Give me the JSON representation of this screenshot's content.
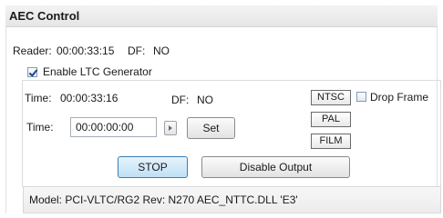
{
  "window": {
    "title": "AEC Control"
  },
  "reader": {
    "label": "Reader:",
    "time": "00:00:33:15",
    "df_label": "DF:",
    "df_value": "NO"
  },
  "ltc": {
    "enable_label": "Enable LTC Generator",
    "enable_checked": true,
    "time_label": "Time:",
    "time_value": "00:00:33:16",
    "df_label": "DF:",
    "df_value": "NO",
    "set_time_label": "Time:",
    "set_time_value": "00:00:00:00",
    "set_label": "Set",
    "ntsc_label": "NTSC",
    "pal_label": "PAL",
    "film_label": "FILM",
    "drop_frame_label": "Drop Frame",
    "drop_frame_checked": false
  },
  "actions": {
    "stop_label": "STOP",
    "disable_label": "Disable Output"
  },
  "status": {
    "model_text": "Model: PCI-VLTC/RG2 Rev: N270 AEC_NTTC.DLL 'E3'"
  },
  "icons": {
    "spin": "triangle-right-icon",
    "check": "check-icon"
  },
  "colors": {
    "stop_accent": "#bfe0f5",
    "border": "#8a8a8a"
  }
}
